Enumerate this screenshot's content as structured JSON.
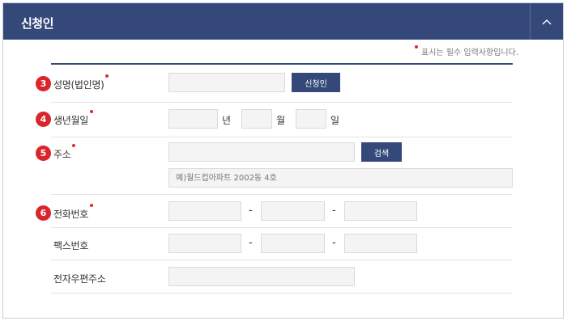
{
  "header": {
    "title": "신청인",
    "collapse_icon": "chevron-up-icon"
  },
  "required_note": "표시는 필수 입력사항입니다.",
  "colors": {
    "header_bg": "#34497a",
    "required_dot": "#e02a2a",
    "badge": "#d9262c"
  },
  "fields": {
    "name": {
      "step": "3",
      "label": "성명(법인명)",
      "button": "신청인"
    },
    "birth": {
      "step": "4",
      "label": "생년월일",
      "year_unit": "년",
      "month_unit": "월",
      "day_unit": "일"
    },
    "address": {
      "step": "5",
      "label": "주소",
      "button": "검색",
      "detail_placeholder": "예)월드컵아파트 2002동 4호"
    },
    "phone": {
      "step": "6",
      "label": "전화번호",
      "sep": "-"
    },
    "fax": {
      "label": "팩스번호",
      "sep": "-"
    },
    "email": {
      "label": "전자우편주소"
    }
  }
}
